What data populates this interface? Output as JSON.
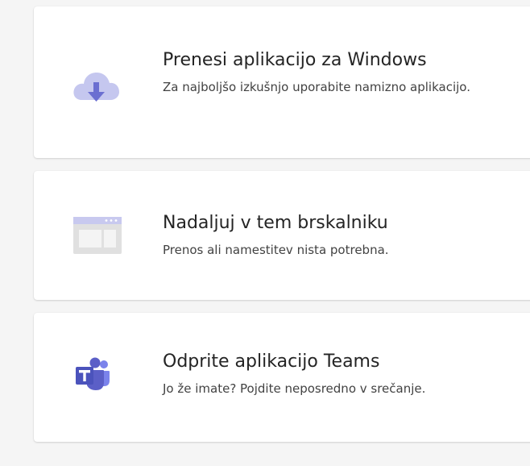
{
  "options": [
    {
      "title": "Prenesi aplikacijo za Windows",
      "subtitle": "Za najboljšo izkušnjo uporabite namizno aplikacijo.",
      "icon": "cloud-download-icon"
    },
    {
      "title": "Nadaljuj v tem brskalniku",
      "subtitle": "Prenos ali namestitev nista potrebna.",
      "icon": "browser-window-icon"
    },
    {
      "title": "Odprite aplikacijo Teams",
      "subtitle": "Jo že imate? Pojdite neposredno v srečanje.",
      "icon": "teams-logo-icon"
    }
  ],
  "colors": {
    "accent": "#5b5fc7",
    "accent_light": "#c5c7ef",
    "text_primary": "#242424",
    "text_secondary": "#424242",
    "background": "#f5f5f5"
  }
}
